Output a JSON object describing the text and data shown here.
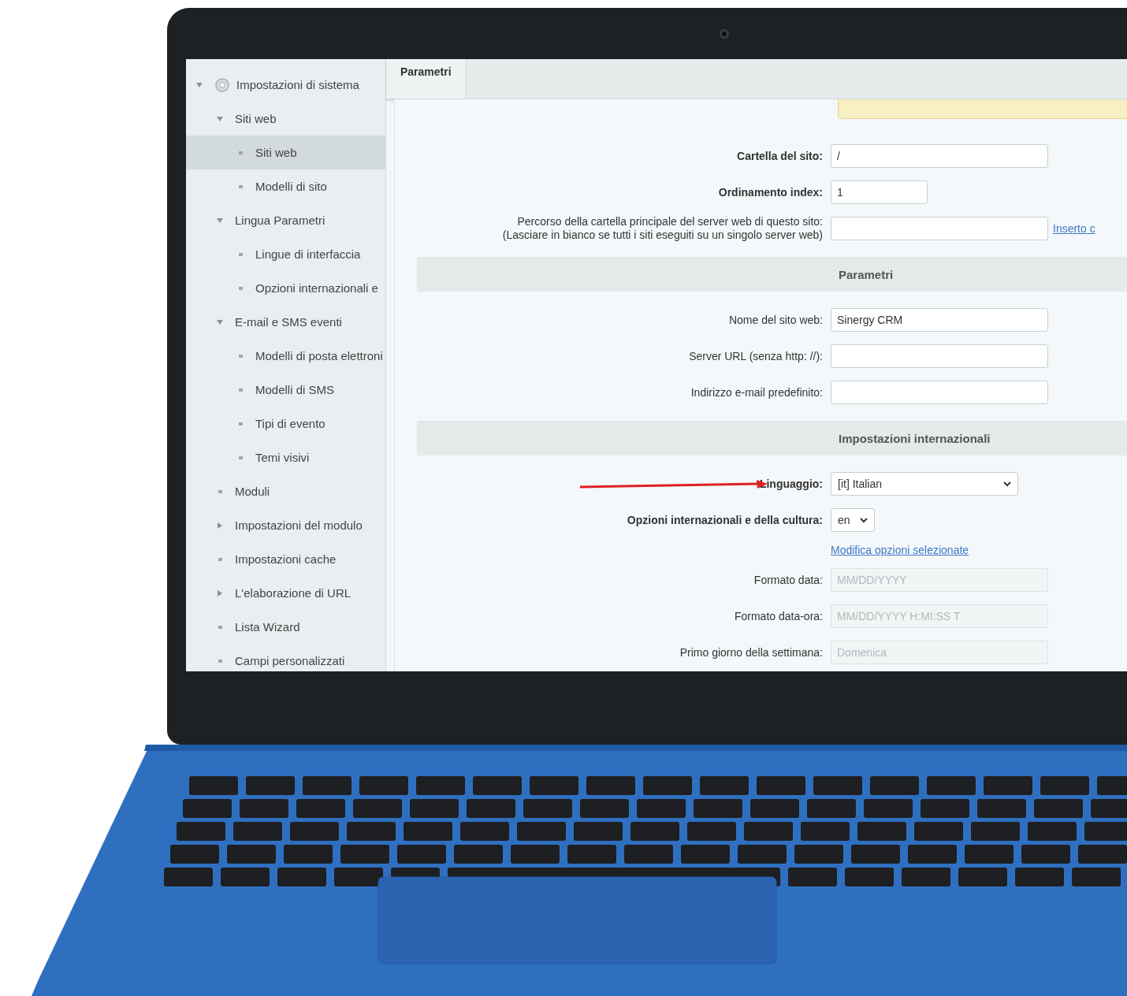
{
  "tree": [
    {
      "label": "Impostazioni di sistema",
      "kind": "root",
      "expanded": true,
      "selected": false,
      "children": [
        {
          "label": "Siti web",
          "kind": "branch",
          "expanded": true,
          "selected": false,
          "children": [
            {
              "label": "Siti web",
              "kind": "leaf",
              "selected": true
            },
            {
              "label": "Modelli di sito",
              "kind": "leaf",
              "selected": false
            }
          ]
        },
        {
          "label": "Lingua Parametri",
          "kind": "branch",
          "expanded": true,
          "selected": false,
          "children": [
            {
              "label": "Lingue di interfaccia",
              "kind": "leaf",
              "selected": false
            },
            {
              "label": "Opzioni internazionali e",
              "kind": "leaf",
              "selected": false
            }
          ]
        },
        {
          "label": "E-mail e SMS eventi",
          "kind": "branch",
          "expanded": true,
          "selected": false,
          "children": [
            {
              "label": "Modelli di posta elettroni",
              "kind": "leaf",
              "selected": false
            },
            {
              "label": "Modelli di SMS",
              "kind": "leaf",
              "selected": false
            },
            {
              "label": "Tipi di evento",
              "kind": "leaf",
              "selected": false
            },
            {
              "label": "Temi visivi",
              "kind": "leaf",
              "selected": false
            }
          ]
        },
        {
          "label": "Moduli",
          "kind": "leaf",
          "selected": false
        },
        {
          "label": "Impostazioni del modulo",
          "kind": "branch",
          "expanded": false,
          "selected": false
        },
        {
          "label": "Impostazioni cache",
          "kind": "leaf",
          "selected": false
        },
        {
          "label": "L'elaborazione di URL",
          "kind": "branch",
          "expanded": false,
          "selected": false
        },
        {
          "label": "Lista Wizard",
          "kind": "leaf",
          "selected": false
        },
        {
          "label": "Campi personalizzati",
          "kind": "leaf",
          "selected": false
        }
      ]
    }
  ],
  "tabs": [
    {
      "label": "Parametri",
      "selected": true
    }
  ],
  "form": [
    {
      "kind": "notice"
    },
    {
      "kind": "input",
      "label": "Cartella del sito:",
      "bold": true,
      "value": "/",
      "disabled": false
    },
    {
      "kind": "number",
      "label": "Ordinamento index:",
      "bold": true,
      "value": "1",
      "disabled": false
    },
    {
      "kind": "input",
      "label": "Percorso della cartella principale del server web di questo sito:\n(Lasciare in bianco se tutti i siti eseguiti su un singolo server web)",
      "bold": false,
      "disabled": false,
      "link": "Inserto c"
    },
    {
      "kind": "section",
      "label": "Parametri"
    },
    {
      "kind": "input",
      "label": "Nome del sito web:",
      "bold": false,
      "value": "Sinergy CRM",
      "disabled": false
    },
    {
      "kind": "input",
      "label": "Server URL (senza http: //):",
      "bold": false,
      "disabled": false
    },
    {
      "kind": "input",
      "label": "Indirizzo e-mail predefinito:",
      "bold": false,
      "disabled": false
    },
    {
      "kind": "section",
      "label": "Impostazioni internazionali"
    },
    {
      "kind": "select",
      "label": "Linguaggio:",
      "bold": true,
      "value": "[it] Italian",
      "annotated": true
    },
    {
      "kind": "compact-select",
      "label": "Opzioni internazionali e della cultura:",
      "bold": true,
      "value": "en",
      "annotated": false
    },
    {
      "kind": "link",
      "label": "Modifica opzioni selezionate"
    },
    {
      "kind": "input",
      "label": "Formato data:",
      "bold": false,
      "value": "MM/DD/YYYY",
      "disabled": true
    },
    {
      "kind": "input",
      "label": "Formato data-ora:",
      "bold": false,
      "value": "MM/DD/YYYY H:MI:SS T",
      "disabled": true
    },
    {
      "kind": "input",
      "label": "Primo giorno della settimana:",
      "bold": false,
      "value": "Domenica",
      "disabled": true
    }
  ]
}
